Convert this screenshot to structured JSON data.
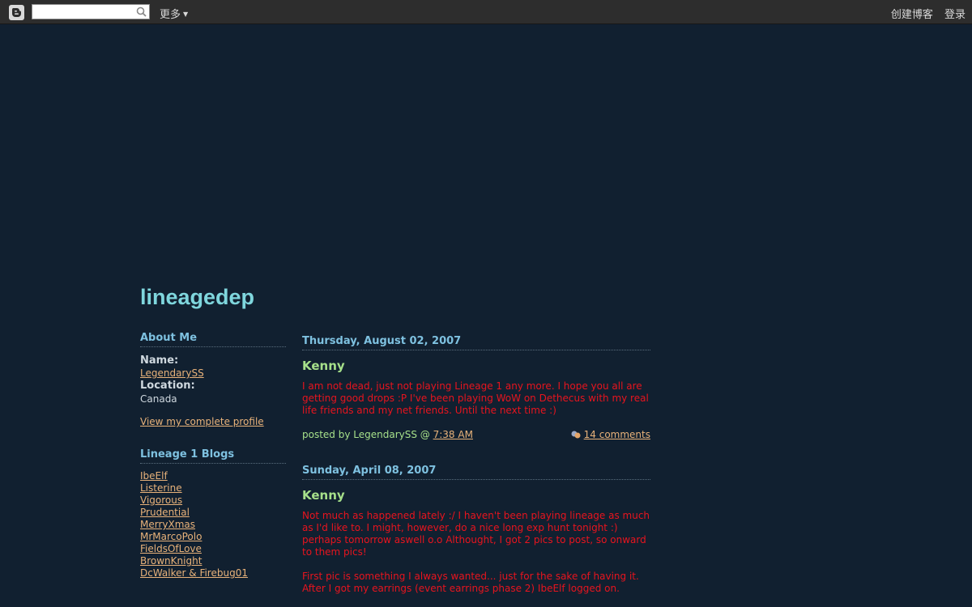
{
  "navbar": {
    "search_placeholder": "",
    "more_label": "更多",
    "create_blog": "创建博客",
    "login": "登录"
  },
  "blog": {
    "title": "lineagedep"
  },
  "sidebar": {
    "about_heading": "About Me",
    "name_label": "Name:",
    "name_value": "LegendarySS",
    "location_label": "Location:",
    "location_value": "Canada",
    "profile_link": "View my complete profile",
    "blogs_heading": "Lineage 1 Blogs",
    "blogs": [
      "IbeElf",
      "Listerine",
      "Vigorous",
      "Prudential",
      "MerryXmas",
      "MrMarcoPolo",
      "FieldsOfLove",
      "BrownKnight",
      "DcWalker & Firebug01"
    ]
  },
  "posts": [
    {
      "date": "Thursday, August 02, 2007",
      "title": "Kenny",
      "body": [
        "I am not dead, just not playing Lineage 1 any more. I hope you all are getting good drops :P I've been playing WoW on Dethecus with my real life friends and my net friends. Until the next time :)"
      ],
      "posted_by": "posted by LegendarySS @",
      "time": "7:38 AM",
      "comments": "14 comments"
    },
    {
      "date": "Sunday, April 08, 2007",
      "title": "Kenny",
      "body": [
        "Not much as happened lately :/ I haven't been playing lineage as much as I'd like to. I might, however, do a nice long exp hunt tonight :) perhaps tomorrow aswell o.o Althought, I got 2 pics to post, so onward to them pics!",
        "First pic is something I always wanted... just for the sake of having it. After I got my earrings (event earrings phase 2) IbeElf logged on."
      ]
    }
  ],
  "colors": {
    "background": "#112030",
    "title": "#7fd6dd",
    "heading": "#7ec1e0",
    "post_title": "#a6e08a",
    "post_body": "#e8141e",
    "link": "#e8b27a"
  }
}
